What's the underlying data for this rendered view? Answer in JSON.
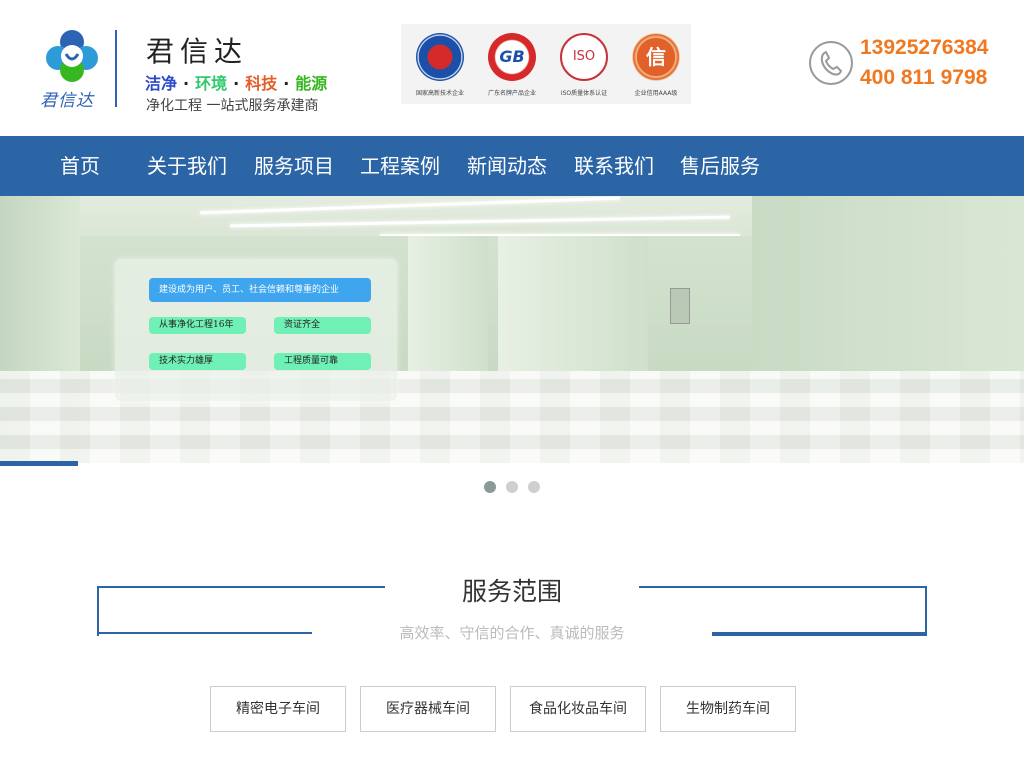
{
  "header": {
    "logo_sub": "君信达",
    "brand_name": "君信达",
    "slogan": [
      "洁净",
      "环境",
      "科技",
      "能源"
    ],
    "slogan_separator": "·",
    "slogan_colors": [
      "#2b49c9",
      "#2ec96b",
      "#e2602a",
      "#36b820"
    ],
    "tagline": "净化工程 一站式服务承建商",
    "certs": [
      {
        "caption": "国家高新技术企业",
        "icon": "high-tech-badge-icon",
        "color": "#1c4fa8"
      },
      {
        "caption": "广东名牌产品企业",
        "icon": "gd-brand-badge-icon",
        "color": "#d62a2a",
        "mark": "GB"
      },
      {
        "caption": "ISO质量体系认证",
        "icon": "iso-badge-icon",
        "color": "#c8323c",
        "mark": "ISO"
      },
      {
        "caption": "企业信用AAA级",
        "icon": "credit-badge-icon",
        "color": "#e2602a",
        "mark": "信"
      }
    ],
    "phone_icon": "phone-icon",
    "phone_1": "13925276384",
    "phone_2": "400 811 9798"
  },
  "nav": {
    "items": [
      "首页",
      "关于我们",
      "服务项目",
      "工程案例",
      "新闻动态",
      "联系我们",
      "售后服务"
    ],
    "background": "#2b65a6"
  },
  "banner": {
    "headline": "建设成为用户、员工、社会信赖和尊重的企业",
    "points": [
      "从事净化工程16年",
      "资证齐全",
      "技术实力雄厚",
      "工程质量可靠"
    ],
    "slides": 3,
    "active_slide": 1
  },
  "services": {
    "title": "服务范围",
    "subtitle": "高效率、守信的合作、真诚的服务",
    "items": [
      "精密电子车间",
      "医疗器械车间",
      "食品化妆品车间",
      "生物制药车间"
    ]
  }
}
